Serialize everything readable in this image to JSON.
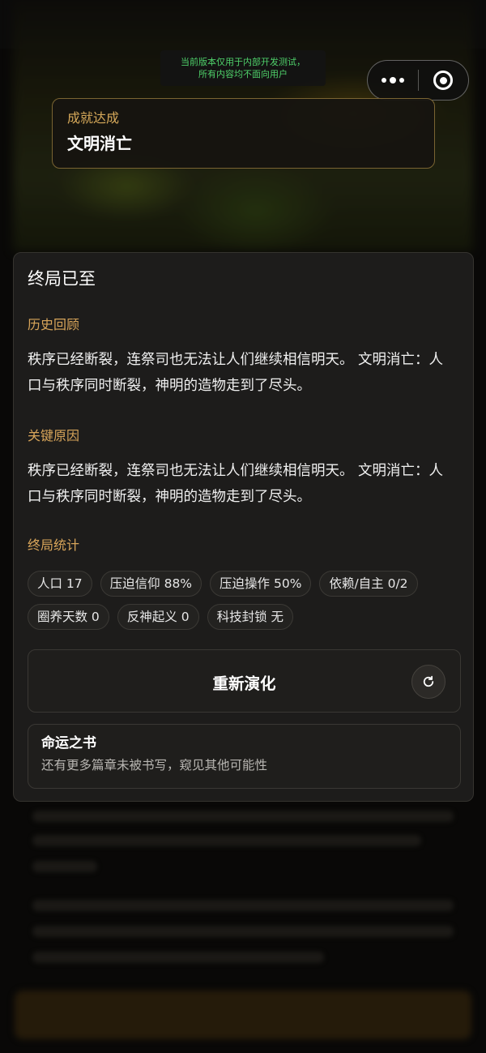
{
  "dev_notice": {
    "line1": "当前版本仅用于内部开发测试，",
    "line2": "所有内容均不面向用户"
  },
  "achievement": {
    "kicker": "成就达成",
    "title": "文明消亡"
  },
  "panel": {
    "title": "终局已至",
    "history": {
      "heading": "历史回顾",
      "text": "秩序已经断裂，连祭司也无法让人们继续相信明天。 文明消亡：人口与秩序同时断裂，神明的造物走到了尽头。"
    },
    "causes": {
      "heading": "关键原因",
      "text": "秩序已经断裂，连祭司也无法让人们继续相信明天。 文明消亡：人口与秩序同时断裂，神明的造物走到了尽头。"
    },
    "stats": {
      "heading": "终局统计",
      "chips": [
        "人口 17",
        "压迫信仰 88%",
        "压迫操作 50%",
        "依赖/自主 0/2",
        "圈养天数 0",
        "反神起义 0",
        "科技封锁 无"
      ]
    },
    "restart_label": "重新演化",
    "book": {
      "title": "命运之书",
      "subtitle": "还有更多篇章未被书写，窥见其他可能性"
    }
  },
  "colors": {
    "accent_gold": "#d8a55a",
    "dev_notice_green": "#4fd06a"
  },
  "icons": [
    "more-dots-icon",
    "target-circle-icon",
    "refresh-icon"
  ]
}
